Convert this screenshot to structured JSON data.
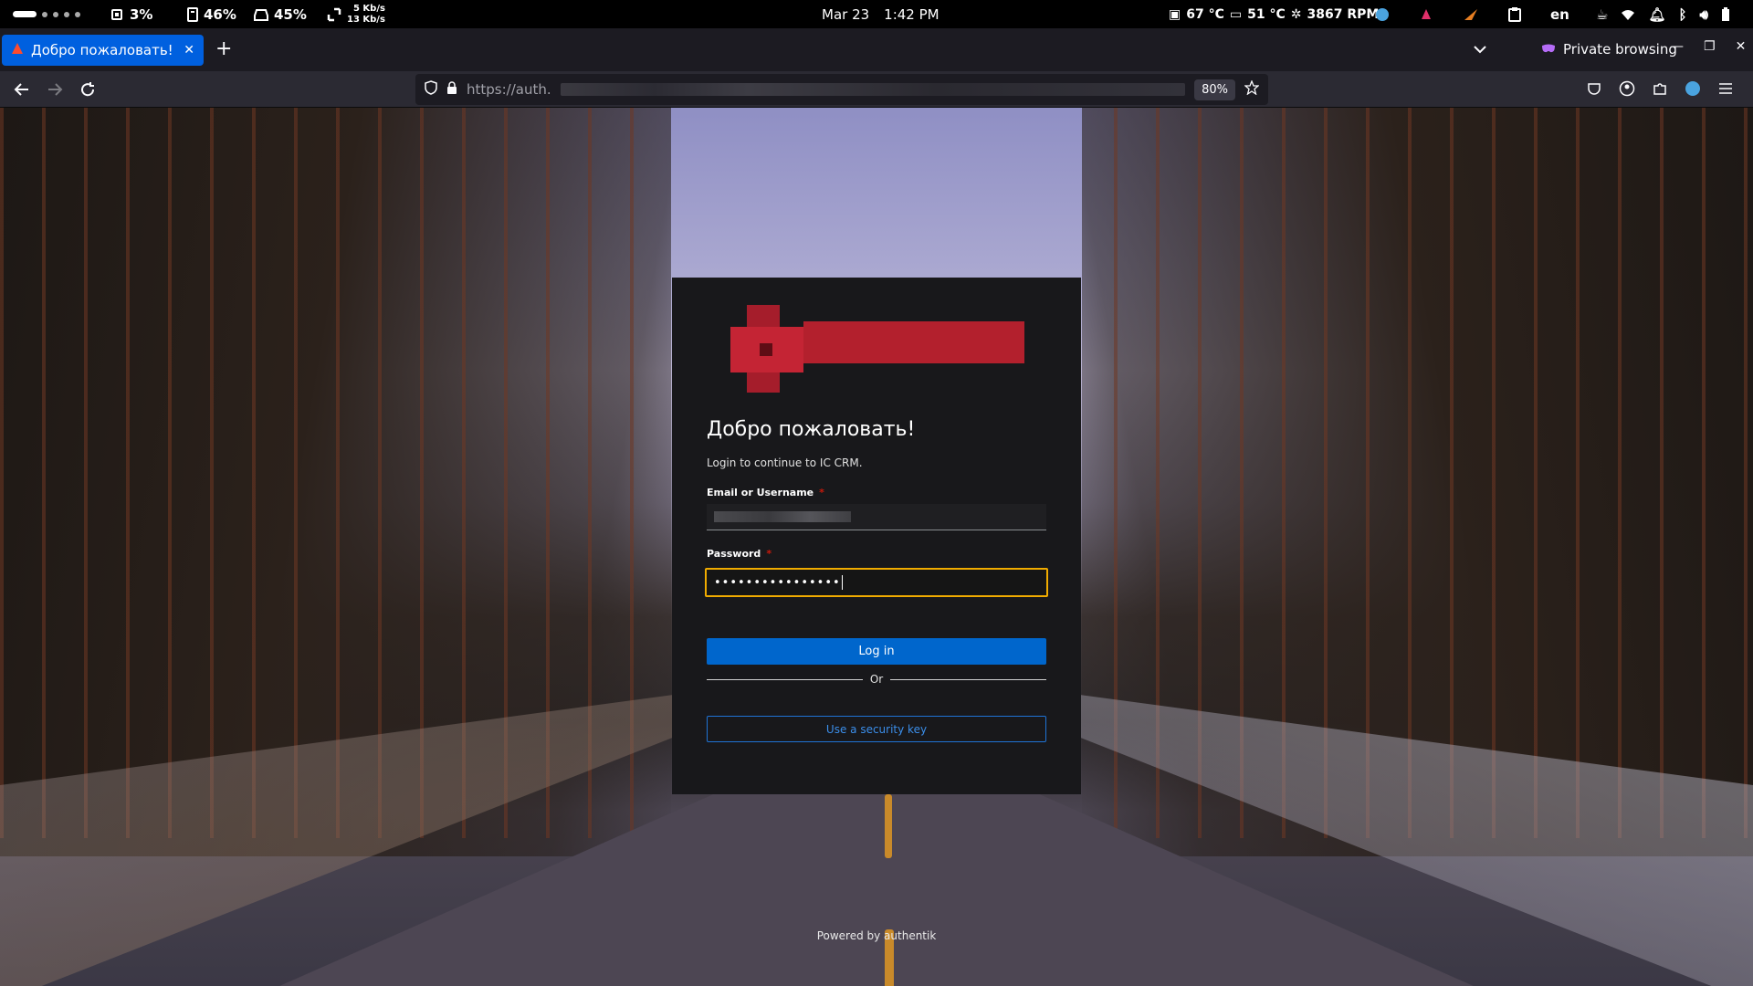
{
  "system_bar": {
    "cpu": "3%",
    "memory": "46%",
    "disk": "45%",
    "net_up": "5 Kb/s",
    "net_down": "13 Kb/s",
    "date": "Mar 23",
    "time": "1:42 PM",
    "cpu_temp": "67 °C",
    "gpu_temp": "51 °C",
    "fan": "3867 RPM",
    "language": "en"
  },
  "browser": {
    "tab_title": "Добро пожаловать! - UN",
    "private_label": "Private browsing",
    "url": "https://auth.",
    "zoom": "80%"
  },
  "login": {
    "heading": "Добро пожаловать!",
    "subtitle": "Login to continue to IC CRM.",
    "username_label": "Email or Username",
    "password_label": "Password",
    "required_mark": "*",
    "password_value": "••••••••••••••••",
    "login_button": "Log in",
    "divider_text": "Or",
    "security_key_button": "Use a security key"
  },
  "footer": {
    "powered_by": "Powered by authentik"
  },
  "colors": {
    "primary": "#0066cc",
    "focus_border": "#f0ab00",
    "required": "#c9190b",
    "card_bg": "#18181b",
    "tab_active": "#0060df"
  }
}
